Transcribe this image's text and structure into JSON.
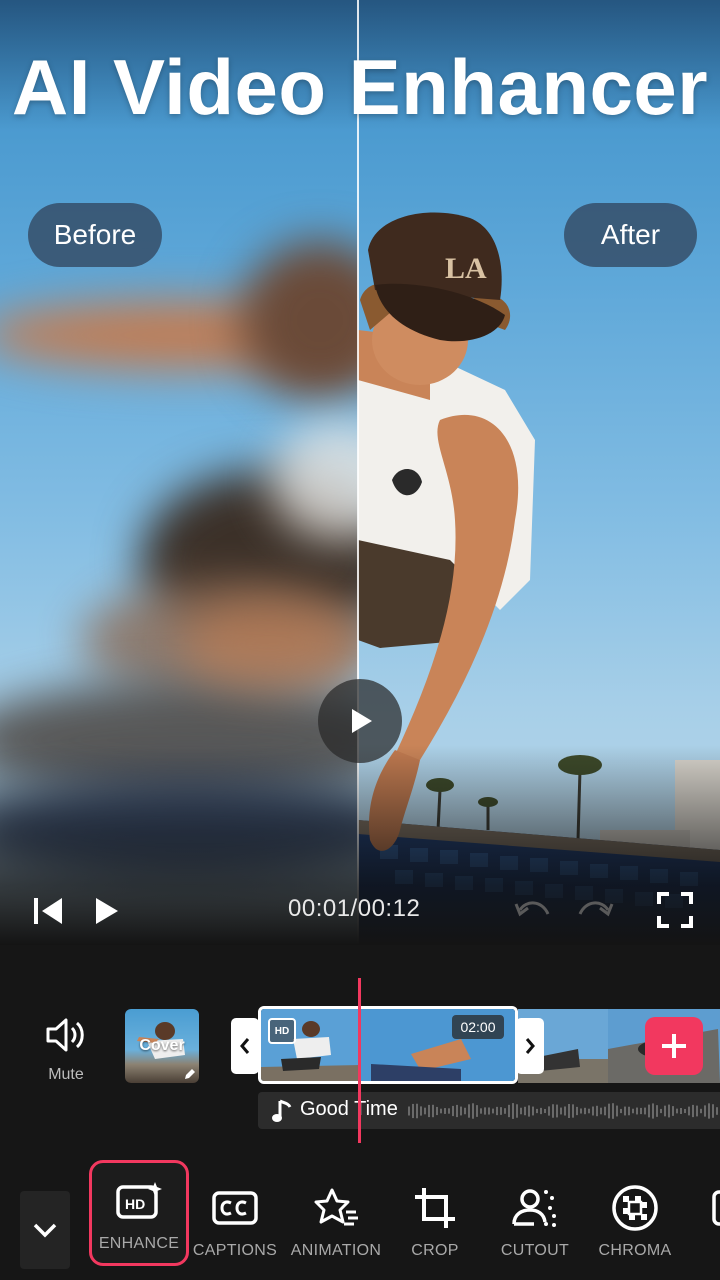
{
  "promo": {
    "title": "AI Video Enhancer",
    "before_label": "Before",
    "after_label": "After"
  },
  "player": {
    "time": "00:01/00:12"
  },
  "timeline": {
    "mute_label": "Mute",
    "cover_label": "Cover",
    "clip_duration": "02:00",
    "hd_badge": "HD",
    "audio_track": "Good Time"
  },
  "toolbar": {
    "tools": [
      {
        "label": "ENHANCE",
        "icon": "hd-sparkle-icon",
        "active": true
      },
      {
        "label": "CAPTIONS",
        "icon": "cc-icon",
        "active": false
      },
      {
        "label": "ANIMATION",
        "icon": "animation-star-icon",
        "active": false
      },
      {
        "label": "CROP",
        "icon": "crop-icon",
        "active": false
      },
      {
        "label": "CUTOUT",
        "icon": "cutout-person-icon",
        "active": false
      },
      {
        "label": "CHROMA",
        "icon": "chroma-icon",
        "active": false
      }
    ]
  },
  "colors": {
    "accent": "#f2385f",
    "background": "#161616"
  }
}
